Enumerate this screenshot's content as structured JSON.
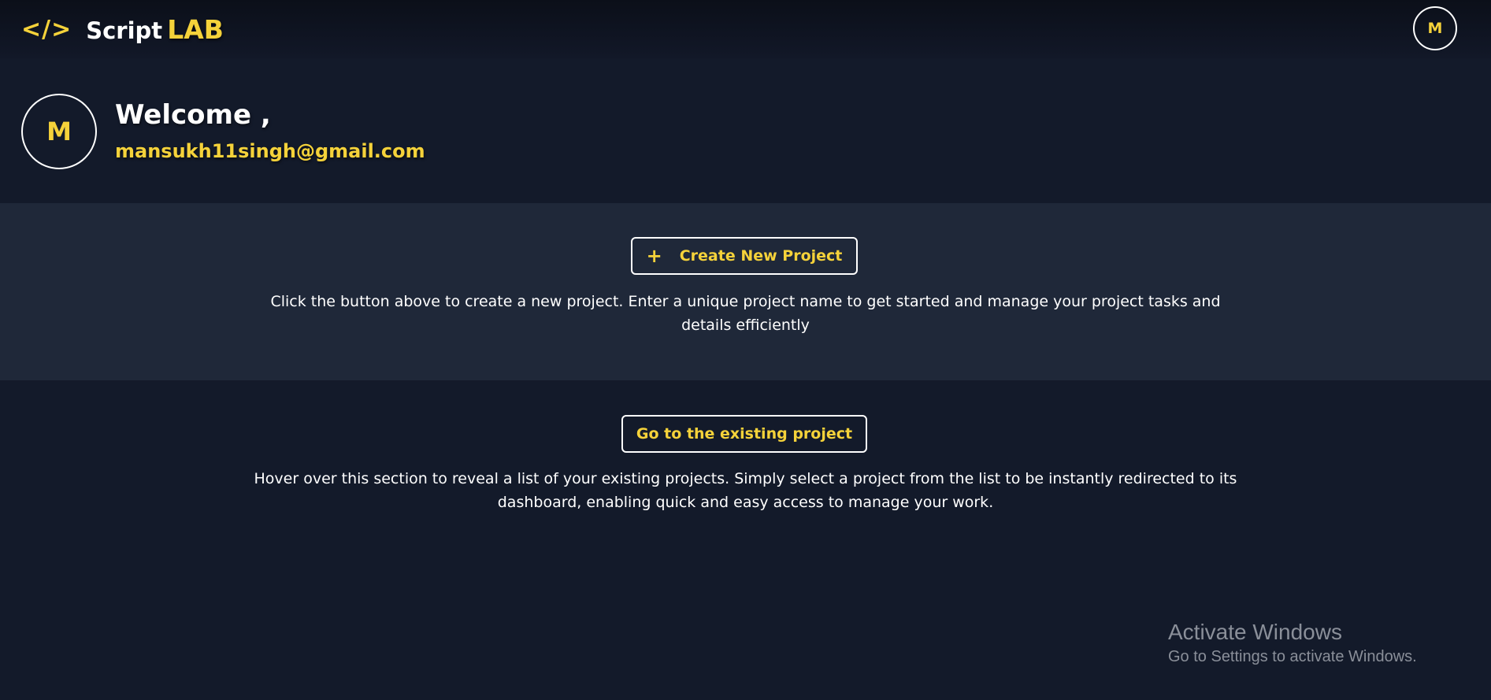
{
  "header": {
    "logo_glyph": "</>",
    "logo_script": "Script",
    "logo_lab": "LAB",
    "avatar_initial": "M"
  },
  "welcome": {
    "avatar_initial": "M",
    "title": "Welcome ,",
    "email": "mansukh11singh@gmail.com"
  },
  "create_section": {
    "button_icon": "+",
    "button_label": "Create New Project",
    "description": "Click the button above to create a new project. Enter a unique project name to get started and manage your project tasks and details efficiently"
  },
  "existing_section": {
    "button_label": "Go to the existing project",
    "description": "Hover over this section to reveal a list of your existing projects. Simply select a project from the list to be instantly redirected to its dashboard, enabling quick and easy access to manage your work."
  },
  "watermark": {
    "title": "Activate Windows",
    "subtitle": "Go to Settings to activate Windows."
  },
  "colors": {
    "accent": "#f5d23a",
    "background": "#131a2a",
    "section_background": "#1f2839"
  },
  "icons": {
    "logo": "code-brackets-icon",
    "create": "plus-icon"
  }
}
